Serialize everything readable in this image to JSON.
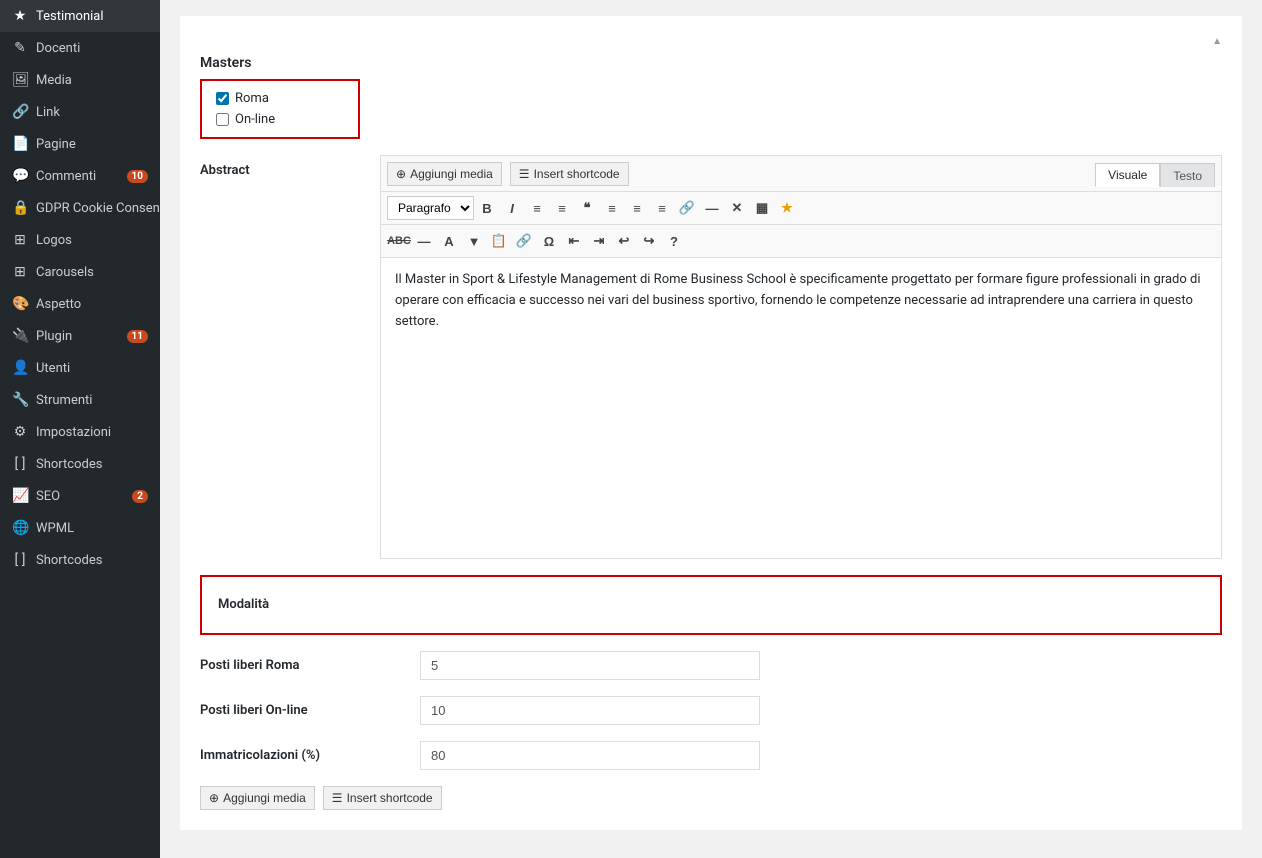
{
  "sidebar": {
    "items": [
      {
        "id": "testimoniala",
        "label": "Testimonial",
        "icon": "★",
        "active": false
      },
      {
        "id": "docenti",
        "label": "Docenti",
        "icon": "✎",
        "active": false
      },
      {
        "id": "media",
        "label": "Media",
        "icon": "🖼",
        "active": false
      },
      {
        "id": "link",
        "label": "Link",
        "icon": "🔗",
        "active": false
      },
      {
        "id": "pagine",
        "label": "Pagine",
        "icon": "📄",
        "active": false
      },
      {
        "id": "commenti",
        "label": "Commenti",
        "icon": "💬",
        "badge": "10",
        "active": false
      },
      {
        "id": "gdpr",
        "label": "GDPR Cookie Consent",
        "icon": "🔒",
        "active": false
      },
      {
        "id": "logos",
        "label": "Logos",
        "icon": "⊞",
        "active": false
      },
      {
        "id": "carousels",
        "label": "Carousels",
        "icon": "⊞",
        "active": false
      },
      {
        "id": "aspetto",
        "label": "Aspetto",
        "icon": "🎨",
        "active": false
      },
      {
        "id": "plugin",
        "label": "Plugin",
        "icon": "🔌",
        "badge": "11",
        "active": false
      },
      {
        "id": "utenti",
        "label": "Utenti",
        "icon": "👤",
        "active": false
      },
      {
        "id": "strumenti",
        "label": "Strumenti",
        "icon": "🔧",
        "active": false
      },
      {
        "id": "impostazioni",
        "label": "Impostazioni",
        "icon": "⚙",
        "active": false
      },
      {
        "id": "shortcodes1",
        "label": "Shortcodes",
        "icon": "[ ]",
        "active": false
      },
      {
        "id": "seo",
        "label": "SEO",
        "icon": "📈",
        "badge": "2",
        "active": false
      },
      {
        "id": "wpml",
        "label": "WPML",
        "icon": "🌐",
        "active": false
      },
      {
        "id": "shortcodes2",
        "label": "Shortcodes",
        "icon": "[ ]",
        "active": false
      }
    ]
  },
  "masters": {
    "label": "Masters",
    "options": [
      {
        "id": "roma",
        "label": "Roma",
        "checked": true
      },
      {
        "id": "online",
        "label": "On-line",
        "checked": false
      }
    ]
  },
  "abstract": {
    "label": "Abstract",
    "toolbar1": {
      "add_media": "Aggiungi media",
      "insert_shortcode": "Insert shortcode",
      "tabs": [
        "Visuale",
        "Testo"
      ]
    },
    "toolbar2": {
      "paragraph_select": "Paragrafo",
      "buttons": [
        "B",
        "I",
        "≡",
        "≡",
        "❝",
        "≡",
        "≡",
        "≡",
        "🔗",
        "—",
        "✕",
        "▦",
        "★"
      ]
    },
    "toolbar3": {
      "buttons": [
        "ABC",
        "—",
        "A",
        "▼",
        "📋",
        "🔗",
        "Ω",
        "⇤",
        "⇥",
        "↩",
        "↪",
        "?"
      ]
    },
    "content": "Il Master in Sport & Lifestyle Management di Rome Business School è specificamente progettato per formare figure professionali in grado di operare con efficacia e successo nei vari del business sportivo, fornendo le competenze necessarie ad intraprendere una carriera in questo settore.",
    "active_tab": "Visuale"
  },
  "modalita": {
    "label": "Modalità"
  },
  "posti_liberi_roma": {
    "label": "Posti liberi Roma",
    "value": "5"
  },
  "posti_liberi_online": {
    "label": "Posti liberi On-line",
    "value": "10"
  },
  "immatricolazioni": {
    "label": "Immatricolazioni (%)",
    "value": "80"
  },
  "bottom_actions": {
    "aggiungi_media": "Aggiungi media",
    "insert_shortcode": "Insert shortcode"
  },
  "colors": {
    "sidebar_bg": "#23282d",
    "sidebar_text": "#ccc",
    "accent": "#0073aa",
    "border_red": "#cc0000",
    "badge_bg": "#ca4a1f"
  }
}
